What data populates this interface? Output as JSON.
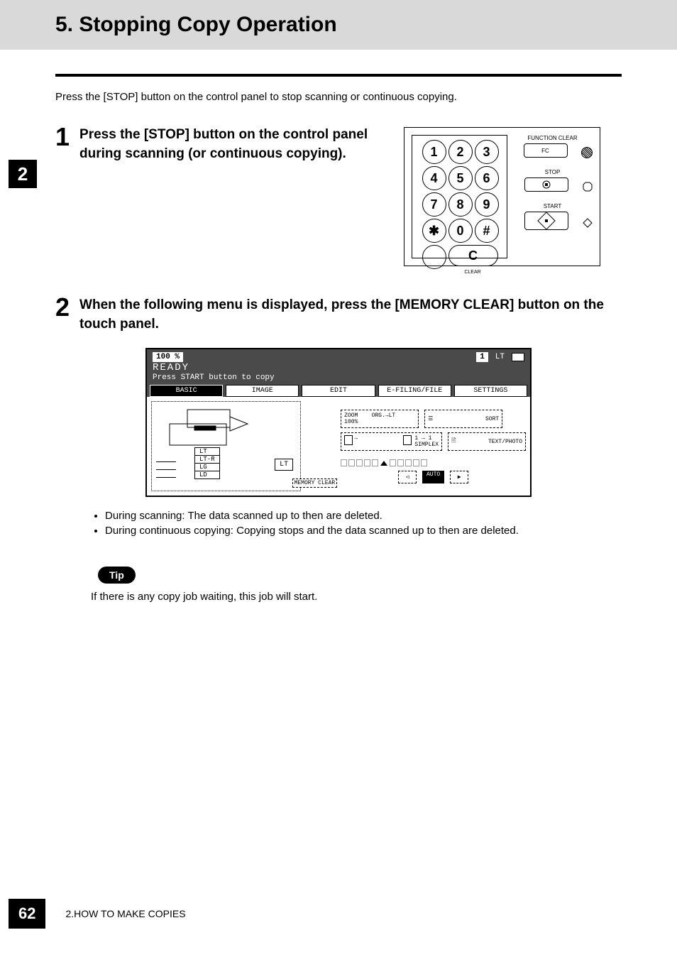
{
  "title": "5. Stopping Copy Operation",
  "sidebar_chapter": "2",
  "intro": "Press the [STOP] button on the control panel to stop scanning or continuous copying.",
  "steps": [
    {
      "num": "1",
      "text": "Press the [STOP] button on the control panel during scanning (or continuous copying)."
    },
    {
      "num": "2",
      "text": "When the following menu is displayed, press the [MEMORY CLEAR] button on the touch panel."
    }
  ],
  "panel": {
    "fc_label": "FUNCTION CLEAR",
    "fc_btn": "FC",
    "stop_label": "STOP",
    "start_label": "START",
    "clear_label": "CLEAR",
    "keys": [
      "1",
      "2",
      "3",
      "4",
      "5",
      "6",
      "7",
      "8",
      "9",
      "✱",
      "0",
      "#"
    ],
    "clear_key": "C"
  },
  "touchpanel": {
    "zoom_pct": "100 %",
    "count": "1",
    "paper_ind": "LT",
    "status": "READY",
    "hint": "Press START button to copy",
    "tabs": [
      "BASIC",
      "IMAGE",
      "EDIT",
      "E-FILING/FILE",
      "SETTINGS"
    ],
    "btns": {
      "zoom": "ZOOM    ORG.→LT\n100%",
      "sort": "SORT",
      "duplex": "1 → 1\nSIMPLEX",
      "mode": "TEXT/PHOTO",
      "mc": "MEMORY CLEAR",
      "auto": "AUTO"
    },
    "paper_list": [
      "LT",
      "LT-R",
      "LG",
      "LD"
    ],
    "lt_badge": "LT"
  },
  "bullets": [
    "During scanning: The data scanned up to then are deleted.",
    "During continuous copying: Copying stops and the data scanned up to then are deleted."
  ],
  "tip_label": "Tip",
  "tip_text": "If there is any copy job waiting, this job will start.",
  "footer": {
    "page": "62",
    "crumb": "2.HOW TO MAKE COPIES"
  }
}
